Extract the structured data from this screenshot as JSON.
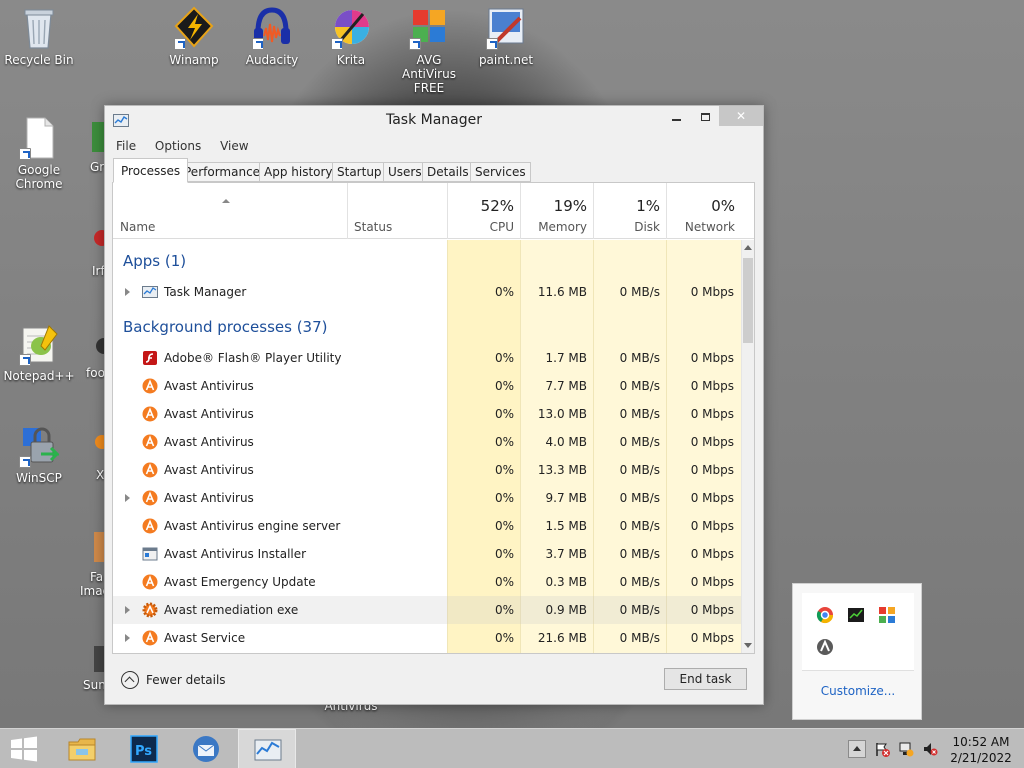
{
  "desktop": {
    "icons": [
      {
        "id": "recycle",
        "label": "Recycle Bin"
      },
      {
        "id": "winamp",
        "label": "Winamp"
      },
      {
        "id": "audacity",
        "label": "Audacity"
      },
      {
        "id": "krita",
        "label": "Krita"
      },
      {
        "id": "avg",
        "label": "AVG AntiVirus FREE"
      },
      {
        "id": "paintnet",
        "label": "paint.net"
      },
      {
        "id": "chrome",
        "label": "Google Chrome"
      },
      {
        "id": "notepadpp",
        "label": "Notepad++"
      },
      {
        "id": "winscp",
        "label": "WinSCP"
      }
    ],
    "partial_labels": {
      "gr": "Gr",
      "irf": "Irf",
      "foo": "foo",
      "x": "X",
      "fa": "Fa",
      "imag": "Imag",
      "sun": "Sun",
      "antivirus": "Antivirus"
    }
  },
  "window": {
    "title": "Task Manager",
    "menu": [
      "File",
      "Options",
      "View"
    ],
    "tabs": [
      "Processes",
      "Performance",
      "App history",
      "Startup",
      "Users",
      "Details",
      "Services"
    ],
    "active_tab": "Processes",
    "columns": {
      "name": "Name",
      "status": "Status",
      "cpu": {
        "pct": "52%",
        "label": "CPU"
      },
      "memory": {
        "pct": "19%",
        "label": "Memory"
      },
      "disk": {
        "pct": "1%",
        "label": "Disk"
      },
      "network": {
        "pct": "0%",
        "label": "Network"
      }
    },
    "groups": {
      "apps": "Apps (1)",
      "background": "Background processes (37)"
    },
    "apps": [
      {
        "name": "Task Manager",
        "cpu": "0%",
        "mem": "11.6 MB",
        "disk": "0 MB/s",
        "net": "0 Mbps",
        "icon": "taskmgr-icon",
        "expandable": true
      }
    ],
    "background": [
      {
        "name": "Adobe® Flash® Player Utility",
        "cpu": "0%",
        "mem": "1.7 MB",
        "disk": "0 MB/s",
        "net": "0 Mbps",
        "icon": "flash-icon",
        "expandable": false
      },
      {
        "name": "Avast Antivirus",
        "cpu": "0%",
        "mem": "7.7 MB",
        "disk": "0 MB/s",
        "net": "0 Mbps",
        "icon": "avast-icon",
        "expandable": false
      },
      {
        "name": "Avast Antivirus",
        "cpu": "0%",
        "mem": "13.0 MB",
        "disk": "0 MB/s",
        "net": "0 Mbps",
        "icon": "avast-icon",
        "expandable": false
      },
      {
        "name": "Avast Antivirus",
        "cpu": "0%",
        "mem": "4.0 MB",
        "disk": "0 MB/s",
        "net": "0 Mbps",
        "icon": "avast-icon",
        "expandable": false
      },
      {
        "name": "Avast Antivirus",
        "cpu": "0%",
        "mem": "13.3 MB",
        "disk": "0 MB/s",
        "net": "0 Mbps",
        "icon": "avast-icon",
        "expandable": false
      },
      {
        "name": "Avast Antivirus",
        "cpu": "0%",
        "mem": "9.7 MB",
        "disk": "0 MB/s",
        "net": "0 Mbps",
        "icon": "avast-icon",
        "expandable": true
      },
      {
        "name": "Avast Antivirus engine server",
        "cpu": "0%",
        "mem": "1.5 MB",
        "disk": "0 MB/s",
        "net": "0 Mbps",
        "icon": "avast-icon",
        "expandable": false
      },
      {
        "name": "Avast Antivirus Installer",
        "cpu": "0%",
        "mem": "3.7 MB",
        "disk": "0 MB/s",
        "net": "0 Mbps",
        "icon": "installer-icon",
        "expandable": false
      },
      {
        "name": "Avast Emergency Update",
        "cpu": "0%",
        "mem": "0.3 MB",
        "disk": "0 MB/s",
        "net": "0 Mbps",
        "icon": "avast-icon",
        "expandable": false
      },
      {
        "name": "Avast remediation exe",
        "cpu": "0%",
        "mem": "0.9 MB",
        "disk": "0 MB/s",
        "net": "0 Mbps",
        "icon": "avast-gear-icon",
        "expandable": true
      },
      {
        "name": "Avast Service",
        "cpu": "0%",
        "mem": "21.6 MB",
        "disk": "0 MB/s",
        "net": "0 Mbps",
        "icon": "avast-icon",
        "expandable": true
      }
    ],
    "footer": {
      "fewer_details": "Fewer details",
      "end_task": "End task"
    }
  },
  "tray_popup": {
    "customize": "Customize..."
  },
  "taskbar": {
    "time": "10:52 AM",
    "date": "2/21/2022"
  },
  "colors": {
    "group_heading": "#1e4f9a",
    "cpu_heat": "#fff4c4",
    "taskbar": "#bcbcbc",
    "link": "#1e63c4"
  }
}
